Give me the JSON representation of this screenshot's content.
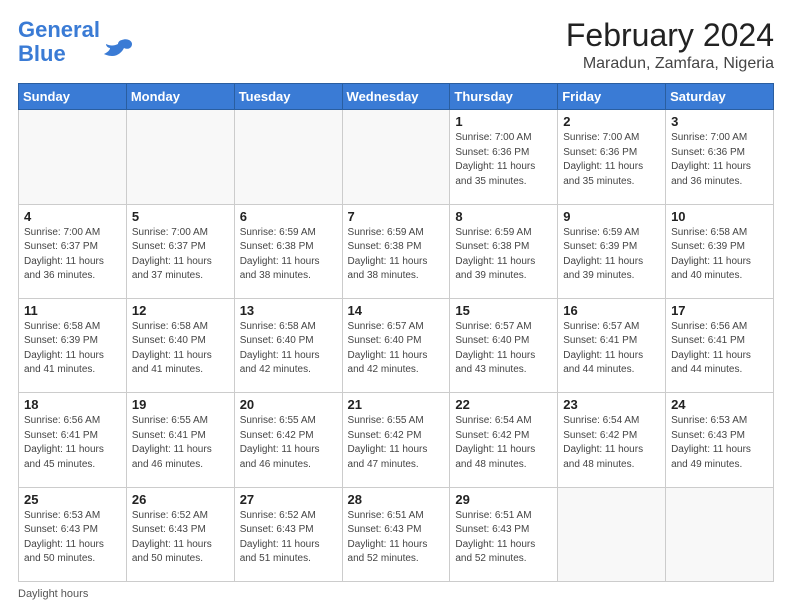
{
  "logo": {
    "line1": "General",
    "line2": "Blue"
  },
  "title": "February 2024",
  "subtitle": "Maradun, Zamfara, Nigeria",
  "weekdays": [
    "Sunday",
    "Monday",
    "Tuesday",
    "Wednesday",
    "Thursday",
    "Friday",
    "Saturday"
  ],
  "footer": "Daylight hours",
  "weeks": [
    [
      {
        "day": "",
        "info": ""
      },
      {
        "day": "",
        "info": ""
      },
      {
        "day": "",
        "info": ""
      },
      {
        "day": "",
        "info": ""
      },
      {
        "day": "1",
        "info": "Sunrise: 7:00 AM\nSunset: 6:36 PM\nDaylight: 11 hours\nand 35 minutes."
      },
      {
        "day": "2",
        "info": "Sunrise: 7:00 AM\nSunset: 6:36 PM\nDaylight: 11 hours\nand 35 minutes."
      },
      {
        "day": "3",
        "info": "Sunrise: 7:00 AM\nSunset: 6:36 PM\nDaylight: 11 hours\nand 36 minutes."
      }
    ],
    [
      {
        "day": "4",
        "info": "Sunrise: 7:00 AM\nSunset: 6:37 PM\nDaylight: 11 hours\nand 36 minutes."
      },
      {
        "day": "5",
        "info": "Sunrise: 7:00 AM\nSunset: 6:37 PM\nDaylight: 11 hours\nand 37 minutes."
      },
      {
        "day": "6",
        "info": "Sunrise: 6:59 AM\nSunset: 6:38 PM\nDaylight: 11 hours\nand 38 minutes."
      },
      {
        "day": "7",
        "info": "Sunrise: 6:59 AM\nSunset: 6:38 PM\nDaylight: 11 hours\nand 38 minutes."
      },
      {
        "day": "8",
        "info": "Sunrise: 6:59 AM\nSunset: 6:38 PM\nDaylight: 11 hours\nand 39 minutes."
      },
      {
        "day": "9",
        "info": "Sunrise: 6:59 AM\nSunset: 6:39 PM\nDaylight: 11 hours\nand 39 minutes."
      },
      {
        "day": "10",
        "info": "Sunrise: 6:58 AM\nSunset: 6:39 PM\nDaylight: 11 hours\nand 40 minutes."
      }
    ],
    [
      {
        "day": "11",
        "info": "Sunrise: 6:58 AM\nSunset: 6:39 PM\nDaylight: 11 hours\nand 41 minutes."
      },
      {
        "day": "12",
        "info": "Sunrise: 6:58 AM\nSunset: 6:40 PM\nDaylight: 11 hours\nand 41 minutes."
      },
      {
        "day": "13",
        "info": "Sunrise: 6:58 AM\nSunset: 6:40 PM\nDaylight: 11 hours\nand 42 minutes."
      },
      {
        "day": "14",
        "info": "Sunrise: 6:57 AM\nSunset: 6:40 PM\nDaylight: 11 hours\nand 42 minutes."
      },
      {
        "day": "15",
        "info": "Sunrise: 6:57 AM\nSunset: 6:40 PM\nDaylight: 11 hours\nand 43 minutes."
      },
      {
        "day": "16",
        "info": "Sunrise: 6:57 AM\nSunset: 6:41 PM\nDaylight: 11 hours\nand 44 minutes."
      },
      {
        "day": "17",
        "info": "Sunrise: 6:56 AM\nSunset: 6:41 PM\nDaylight: 11 hours\nand 44 minutes."
      }
    ],
    [
      {
        "day": "18",
        "info": "Sunrise: 6:56 AM\nSunset: 6:41 PM\nDaylight: 11 hours\nand 45 minutes."
      },
      {
        "day": "19",
        "info": "Sunrise: 6:55 AM\nSunset: 6:41 PM\nDaylight: 11 hours\nand 46 minutes."
      },
      {
        "day": "20",
        "info": "Sunrise: 6:55 AM\nSunset: 6:42 PM\nDaylight: 11 hours\nand 46 minutes."
      },
      {
        "day": "21",
        "info": "Sunrise: 6:55 AM\nSunset: 6:42 PM\nDaylight: 11 hours\nand 47 minutes."
      },
      {
        "day": "22",
        "info": "Sunrise: 6:54 AM\nSunset: 6:42 PM\nDaylight: 11 hours\nand 48 minutes."
      },
      {
        "day": "23",
        "info": "Sunrise: 6:54 AM\nSunset: 6:42 PM\nDaylight: 11 hours\nand 48 minutes."
      },
      {
        "day": "24",
        "info": "Sunrise: 6:53 AM\nSunset: 6:43 PM\nDaylight: 11 hours\nand 49 minutes."
      }
    ],
    [
      {
        "day": "25",
        "info": "Sunrise: 6:53 AM\nSunset: 6:43 PM\nDaylight: 11 hours\nand 50 minutes."
      },
      {
        "day": "26",
        "info": "Sunrise: 6:52 AM\nSunset: 6:43 PM\nDaylight: 11 hours\nand 50 minutes."
      },
      {
        "day": "27",
        "info": "Sunrise: 6:52 AM\nSunset: 6:43 PM\nDaylight: 11 hours\nand 51 minutes."
      },
      {
        "day": "28",
        "info": "Sunrise: 6:51 AM\nSunset: 6:43 PM\nDaylight: 11 hours\nand 52 minutes."
      },
      {
        "day": "29",
        "info": "Sunrise: 6:51 AM\nSunset: 6:43 PM\nDaylight: 11 hours\nand 52 minutes."
      },
      {
        "day": "",
        "info": ""
      },
      {
        "day": "",
        "info": ""
      }
    ]
  ]
}
